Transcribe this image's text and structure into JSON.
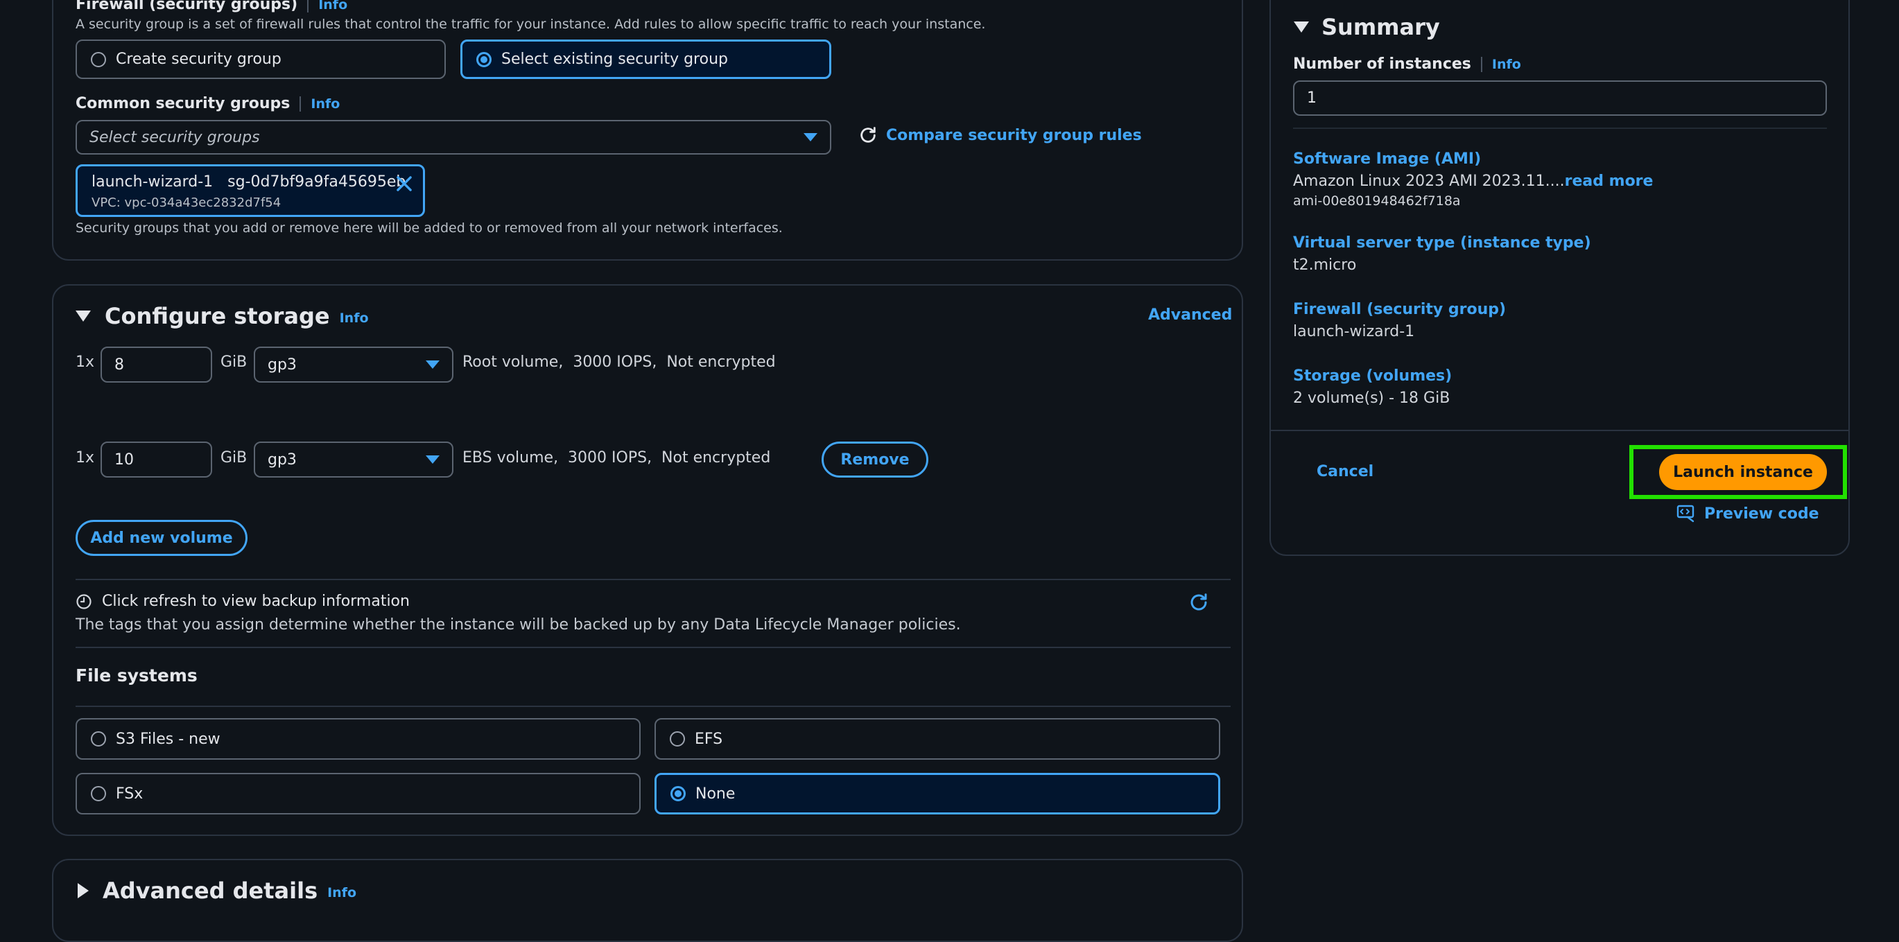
{
  "firewall": {
    "title": "Firewall (security groups)",
    "info": "Info",
    "description": "A security group is a set of firewall rules that control the traffic for your instance. Add rules to allow specific traffic to reach your instance.",
    "option_create": "Create security group",
    "option_existing": "Select existing security group",
    "common_title": "Common security groups",
    "common_info": "Info",
    "select_placeholder": "Select security groups",
    "compare_link": "Compare security group rules",
    "token_name": "launch-wizard-1",
    "token_id": "sg-0d7bf9a9fa45695eb",
    "token_vpc": "VPC: vpc-034a43ec2832d7f54",
    "note": "Security groups that you add or remove here will be added to or removed from all your network interfaces."
  },
  "storage": {
    "title": "Configure storage",
    "info": "Info",
    "advanced": "Advanced",
    "volumes": [
      {
        "multiplier": "1x",
        "size": "8",
        "unit": "GiB",
        "type": "gp3",
        "desc": "Root volume,  3000 IOPS,  Not encrypted"
      },
      {
        "multiplier": "1x",
        "size": "10",
        "unit": "GiB",
        "type": "gp3",
        "desc": "EBS volume,  3000 IOPS,  Not encrypted",
        "remove": "Remove"
      }
    ],
    "add_volume": "Add new volume",
    "backup_title": "Click refresh to view backup information",
    "backup_desc": "The tags that you assign determine whether the instance will be backed up by any Data Lifecycle Manager policies.",
    "file_systems_title": "File systems",
    "fs_options": [
      "S3 Files - new",
      "EFS",
      "FSx",
      "None"
    ]
  },
  "advanced_details": {
    "title": "Advanced details",
    "info": "Info"
  },
  "summary": {
    "title": "Summary",
    "num_label": "Number of instances",
    "num_info": "Info",
    "num_value": "1",
    "ami_label": "Software Image (AMI)",
    "ami_value": "Amazon Linux 2023 AMI 2023.11....",
    "ami_read_more": "read more",
    "ami_id": "ami-00e801948462f718a",
    "type_label": "Virtual server type (instance type)",
    "type_value": "t2.micro",
    "fw_label": "Firewall (security group)",
    "fw_value": "launch-wizard-1",
    "storage_label": "Storage (volumes)",
    "storage_value": "2 volume(s) - 18 GiB",
    "cancel": "Cancel",
    "launch": "Launch instance",
    "preview": "Preview code"
  },
  "colors": {
    "accent": "#42a5f5",
    "launch_button": "#ff9900",
    "highlight_box": "#22e000",
    "background": "#0f141a"
  }
}
